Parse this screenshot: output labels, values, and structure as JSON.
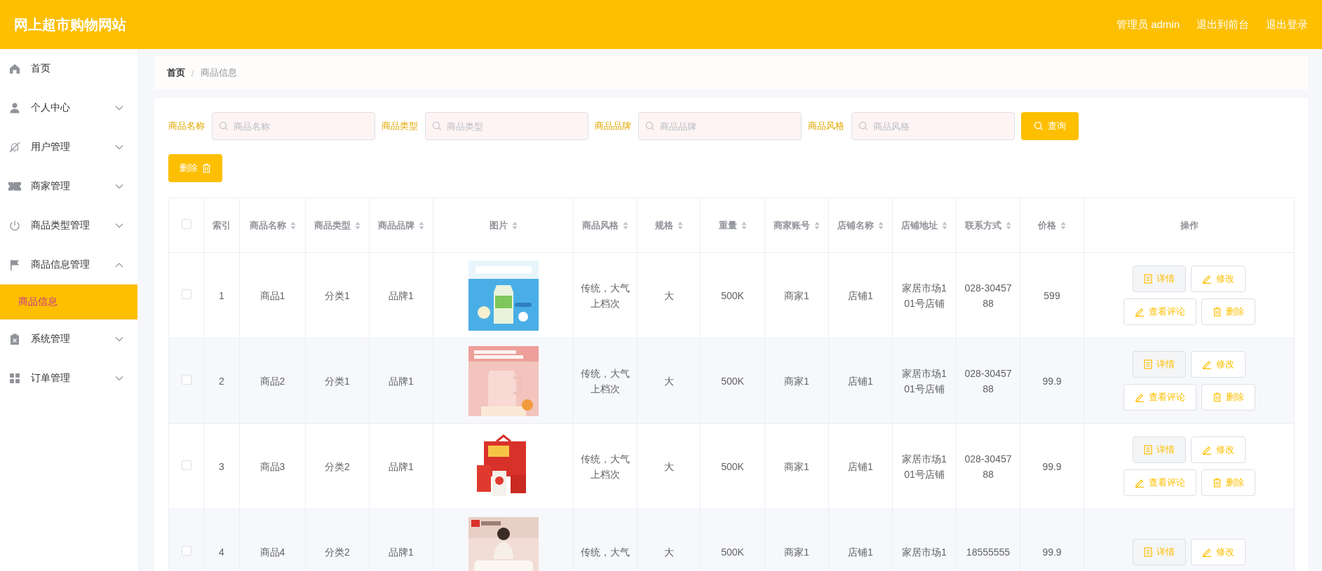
{
  "header": {
    "title": "网上超市购物网站",
    "links": [
      "管理员 admin",
      "退出到前台",
      "退出登录"
    ]
  },
  "sidebar": {
    "items": [
      {
        "label": "首页",
        "selected": false
      },
      {
        "label": "个人中心",
        "selected": false,
        "expanded": false
      },
      {
        "label": "用户管理",
        "selected": false,
        "expanded": false
      },
      {
        "label": "商家管理",
        "selected": false,
        "expanded": false
      },
      {
        "label": "商品类型管理",
        "selected": false,
        "expanded": false
      },
      {
        "label": "商品信息管理",
        "selected": false,
        "expanded": true,
        "children": [
          {
            "label": "商品信息",
            "selected": true
          }
        ]
      },
      {
        "label": "系统管理",
        "selected": false,
        "expanded": false
      },
      {
        "label": "订单管理",
        "selected": false,
        "expanded": false
      }
    ]
  },
  "breadcrumb": [
    "首页",
    "/",
    "商品信息"
  ],
  "search": {
    "fields": [
      {
        "label": "商品名称",
        "placeholder": "商品名称"
      },
      {
        "label": "商品类型",
        "placeholder": "商品类型"
      },
      {
        "label": "商品品牌",
        "placeholder": "商品品牌"
      },
      {
        "label": "商品风格",
        "placeholder": "商品风格"
      }
    ],
    "button": "查询"
  },
  "delete_button": "删除",
  "table": {
    "select_all": {
      "checked": false
    },
    "columns": [
      {
        "label": "索引",
        "sortable": false
      },
      {
        "label": "商品名称",
        "sortable": true
      },
      {
        "label": "商品类型",
        "sortable": true
      },
      {
        "label": "商品品牌",
        "sortable": true
      },
      {
        "label": "图片",
        "sortable": true
      },
      {
        "label": "商品风格",
        "sortable": true
      },
      {
        "label": "规格",
        "sortable": true
      },
      {
        "label": "重量",
        "sortable": true
      },
      {
        "label": "商家账号",
        "sortable": true
      },
      {
        "label": "店铺名称",
        "sortable": true
      },
      {
        "label": "店铺地址",
        "sortable": true
      },
      {
        "label": "联系方式",
        "sortable": true
      },
      {
        "label": "价格",
        "sortable": true
      },
      {
        "label": "操作",
        "sortable": false
      }
    ],
    "rows": [
      {
        "checked": false,
        "cells": [
          "1",
          "商品1",
          "分类1",
          "品牌1",
          {
            "kind": "picture"
          },
          "传统，大气上档次",
          "大",
          "500K",
          "商家1",
          "店铺1",
          "家居市场101号店铺",
          "028-3045788",
          "599"
        ],
        "actions": [
          {
            "label": "详情",
            "kind": "detail"
          },
          {
            "label": "修改",
            "kind": "edit"
          },
          {
            "label": "查看评论",
            "kind": "comment"
          },
          {
            "label": "删除",
            "kind": "delete"
          }
        ]
      },
      {
        "checked": false,
        "cells": [
          "2",
          "商品2",
          "分类1",
          "品牌1",
          {
            "kind": "picture"
          },
          "传统，大气上档次",
          "大",
          "500K",
          "商家1",
          "店铺1",
          "家居市场101号店铺",
          "028-3045788",
          "99.9"
        ],
        "actions": [
          {
            "label": "详情",
            "kind": "detail"
          },
          {
            "label": "修改",
            "kind": "edit"
          },
          {
            "label": "查看评论",
            "kind": "comment"
          },
          {
            "label": "删除",
            "kind": "delete"
          }
        ]
      },
      {
        "checked": false,
        "cells": [
          "3",
          "商品3",
          "分类2",
          "品牌1",
          {
            "kind": "picture"
          },
          "传统，大气上档次",
          "大",
          "500K",
          "商家1",
          "店铺1",
          "家居市场101号店铺",
          "028-3045788",
          "99.9"
        ],
        "actions": [
          {
            "label": "详情",
            "kind": "detail"
          },
          {
            "label": "修改",
            "kind": "edit"
          },
          {
            "label": "查看评论",
            "kind": "comment"
          },
          {
            "label": "删除",
            "kind": "delete"
          }
        ]
      },
      {
        "checked": false,
        "cells": [
          "4",
          "商品4",
          "分类2",
          "品牌1",
          {
            "kind": "picture"
          },
          "传统，大气",
          "大",
          "500K",
          "商家1",
          "店铺1",
          "家居市场1",
          "18555555",
          "99.9"
        ],
        "actions": [
          {
            "label": "详情",
            "kind": "detail"
          },
          {
            "label": "修改",
            "kind": "edit"
          }
        ]
      }
    ]
  }
}
